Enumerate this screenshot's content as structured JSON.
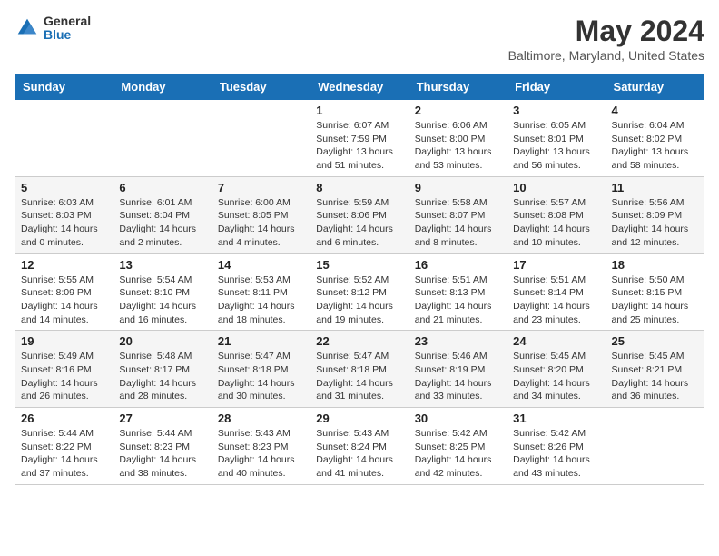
{
  "logo": {
    "general": "General",
    "blue": "Blue"
  },
  "header": {
    "month": "May 2024",
    "location": "Baltimore, Maryland, United States"
  },
  "days_of_week": [
    "Sunday",
    "Monday",
    "Tuesday",
    "Wednesday",
    "Thursday",
    "Friday",
    "Saturday"
  ],
  "weeks": [
    [
      {
        "day": "",
        "info": ""
      },
      {
        "day": "",
        "info": ""
      },
      {
        "day": "",
        "info": ""
      },
      {
        "day": "1",
        "info": "Sunrise: 6:07 AM\nSunset: 7:59 PM\nDaylight: 13 hours\nand 51 minutes."
      },
      {
        "day": "2",
        "info": "Sunrise: 6:06 AM\nSunset: 8:00 PM\nDaylight: 13 hours\nand 53 minutes."
      },
      {
        "day": "3",
        "info": "Sunrise: 6:05 AM\nSunset: 8:01 PM\nDaylight: 13 hours\nand 56 minutes."
      },
      {
        "day": "4",
        "info": "Sunrise: 6:04 AM\nSunset: 8:02 PM\nDaylight: 13 hours\nand 58 minutes."
      }
    ],
    [
      {
        "day": "5",
        "info": "Sunrise: 6:03 AM\nSunset: 8:03 PM\nDaylight: 14 hours\nand 0 minutes."
      },
      {
        "day": "6",
        "info": "Sunrise: 6:01 AM\nSunset: 8:04 PM\nDaylight: 14 hours\nand 2 minutes."
      },
      {
        "day": "7",
        "info": "Sunrise: 6:00 AM\nSunset: 8:05 PM\nDaylight: 14 hours\nand 4 minutes."
      },
      {
        "day": "8",
        "info": "Sunrise: 5:59 AM\nSunset: 8:06 PM\nDaylight: 14 hours\nand 6 minutes."
      },
      {
        "day": "9",
        "info": "Sunrise: 5:58 AM\nSunset: 8:07 PM\nDaylight: 14 hours\nand 8 minutes."
      },
      {
        "day": "10",
        "info": "Sunrise: 5:57 AM\nSunset: 8:08 PM\nDaylight: 14 hours\nand 10 minutes."
      },
      {
        "day": "11",
        "info": "Sunrise: 5:56 AM\nSunset: 8:09 PM\nDaylight: 14 hours\nand 12 minutes."
      }
    ],
    [
      {
        "day": "12",
        "info": "Sunrise: 5:55 AM\nSunset: 8:09 PM\nDaylight: 14 hours\nand 14 minutes."
      },
      {
        "day": "13",
        "info": "Sunrise: 5:54 AM\nSunset: 8:10 PM\nDaylight: 14 hours\nand 16 minutes."
      },
      {
        "day": "14",
        "info": "Sunrise: 5:53 AM\nSunset: 8:11 PM\nDaylight: 14 hours\nand 18 minutes."
      },
      {
        "day": "15",
        "info": "Sunrise: 5:52 AM\nSunset: 8:12 PM\nDaylight: 14 hours\nand 19 minutes."
      },
      {
        "day": "16",
        "info": "Sunrise: 5:51 AM\nSunset: 8:13 PM\nDaylight: 14 hours\nand 21 minutes."
      },
      {
        "day": "17",
        "info": "Sunrise: 5:51 AM\nSunset: 8:14 PM\nDaylight: 14 hours\nand 23 minutes."
      },
      {
        "day": "18",
        "info": "Sunrise: 5:50 AM\nSunset: 8:15 PM\nDaylight: 14 hours\nand 25 minutes."
      }
    ],
    [
      {
        "day": "19",
        "info": "Sunrise: 5:49 AM\nSunset: 8:16 PM\nDaylight: 14 hours\nand 26 minutes."
      },
      {
        "day": "20",
        "info": "Sunrise: 5:48 AM\nSunset: 8:17 PM\nDaylight: 14 hours\nand 28 minutes."
      },
      {
        "day": "21",
        "info": "Sunrise: 5:47 AM\nSunset: 8:18 PM\nDaylight: 14 hours\nand 30 minutes."
      },
      {
        "day": "22",
        "info": "Sunrise: 5:47 AM\nSunset: 8:18 PM\nDaylight: 14 hours\nand 31 minutes."
      },
      {
        "day": "23",
        "info": "Sunrise: 5:46 AM\nSunset: 8:19 PM\nDaylight: 14 hours\nand 33 minutes."
      },
      {
        "day": "24",
        "info": "Sunrise: 5:45 AM\nSunset: 8:20 PM\nDaylight: 14 hours\nand 34 minutes."
      },
      {
        "day": "25",
        "info": "Sunrise: 5:45 AM\nSunset: 8:21 PM\nDaylight: 14 hours\nand 36 minutes."
      }
    ],
    [
      {
        "day": "26",
        "info": "Sunrise: 5:44 AM\nSunset: 8:22 PM\nDaylight: 14 hours\nand 37 minutes."
      },
      {
        "day": "27",
        "info": "Sunrise: 5:44 AM\nSunset: 8:23 PM\nDaylight: 14 hours\nand 38 minutes."
      },
      {
        "day": "28",
        "info": "Sunrise: 5:43 AM\nSunset: 8:23 PM\nDaylight: 14 hours\nand 40 minutes."
      },
      {
        "day": "29",
        "info": "Sunrise: 5:43 AM\nSunset: 8:24 PM\nDaylight: 14 hours\nand 41 minutes."
      },
      {
        "day": "30",
        "info": "Sunrise: 5:42 AM\nSunset: 8:25 PM\nDaylight: 14 hours\nand 42 minutes."
      },
      {
        "day": "31",
        "info": "Sunrise: 5:42 AM\nSunset: 8:26 PM\nDaylight: 14 hours\nand 43 minutes."
      },
      {
        "day": "",
        "info": ""
      }
    ]
  ]
}
